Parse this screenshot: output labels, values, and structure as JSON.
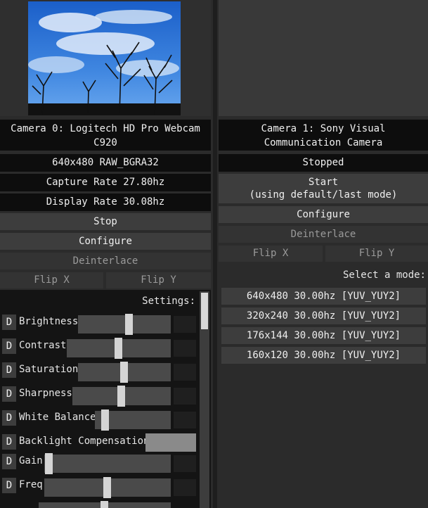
{
  "camera0": {
    "title": "Camera 0: Logitech HD Pro Webcam\nC920",
    "format": "640x480 RAW_BGRA32",
    "capture_rate": "Capture Rate 27.80hz",
    "display_rate": "Display Rate 30.08hz",
    "stop_label": "Stop",
    "configure_label": "Configure",
    "deinterlace_label": "Deinterlace",
    "flip_x_label": "Flip X",
    "flip_y_label": "Flip Y",
    "settings_label": "Settings:",
    "settings": [
      {
        "d": "D",
        "label": "Brightness",
        "level": 0.55
      },
      {
        "d": "D",
        "label": "Contrast",
        "level": 0.5
      },
      {
        "d": "D",
        "label": "Saturation",
        "level": 0.5
      },
      {
        "d": "D",
        "label": "Sharpness",
        "level": 0.5
      },
      {
        "d": "D",
        "label": "White Balance",
        "level": 0.1
      },
      {
        "d": "D",
        "label": "Backlight Compensation",
        "level": 1.0
      },
      {
        "d": "D",
        "label": "Gain",
        "level": 0.0
      },
      {
        "d": "D",
        "label": "Freq",
        "level": 0.5
      }
    ]
  },
  "camera1": {
    "title": "Camera 1: Sony Visual\nCommunication Camera",
    "status": "Stopped",
    "start_label": "Start\n(using default/last mode)",
    "configure_label": "Configure",
    "deinterlace_label": "Deinterlace",
    "flip_x_label": "Flip X",
    "flip_y_label": "Flip Y",
    "select_mode_label": "Select a mode:",
    "modes": [
      "640x480 30.00hz [YUV_YUY2]",
      "320x240 30.00hz [YUV_YUY2]",
      "176x144 30.00hz [YUV_YUY2]",
      "160x120 30.00hz [YUV_YUY2]"
    ]
  },
  "colors": {
    "background": "#2b2b2b",
    "label_bg": "#0d0d0d",
    "button_bg": "#3d3d3d",
    "slider_knob": "#d4d4d4"
  }
}
